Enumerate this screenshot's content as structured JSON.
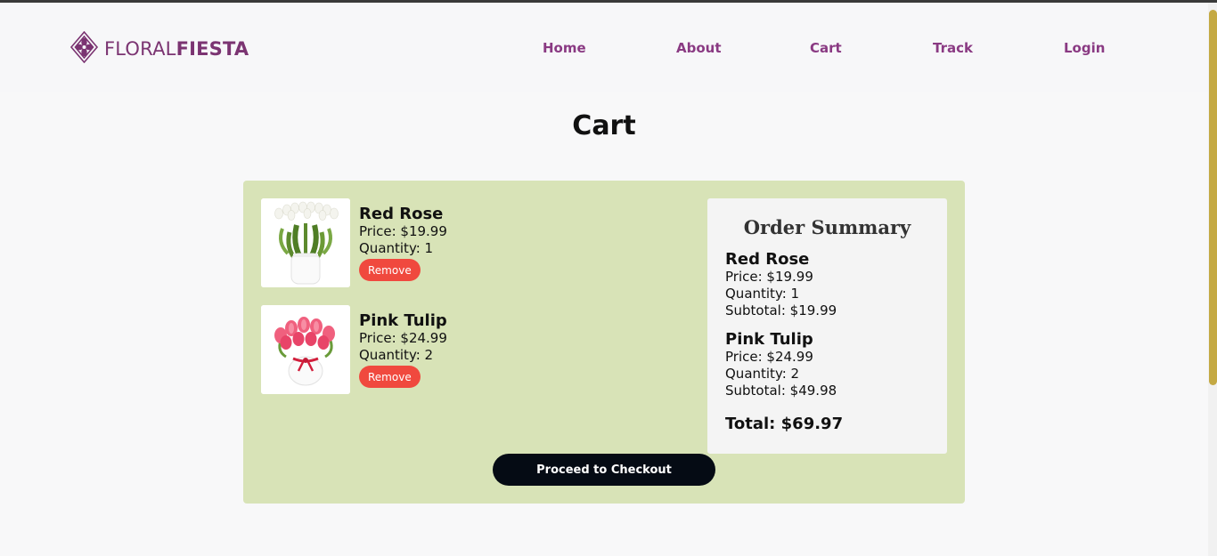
{
  "brand": {
    "name_light": "FLORAL",
    "name_bold": "FIESTA",
    "color": "#7b3472",
    "icon": "flower-diamond-logo-icon"
  },
  "nav": {
    "items": [
      {
        "label": "Home"
      },
      {
        "label": "About"
      },
      {
        "label": "Cart"
      },
      {
        "label": "Track"
      },
      {
        "label": "Login"
      }
    ],
    "color": "#8a3a83"
  },
  "page": {
    "title": "Cart"
  },
  "cart": {
    "panel_color": "#d8e3b7",
    "items": [
      {
        "name": "Red Rose",
        "price": "Price: $19.99",
        "quantity": "Quantity: 1",
        "remove_label": "Remove",
        "image": "white-tulips-vase-image"
      },
      {
        "name": "Pink Tulip",
        "price": "Price: $24.99",
        "quantity": "Quantity: 2",
        "remove_label": "Remove",
        "image": "pink-tulips-vase-image"
      }
    ],
    "checkout_label": "Proceed to Checkout"
  },
  "summary": {
    "title": "Order Summary",
    "items": [
      {
        "name": "Red Rose",
        "price": "Price: $19.99",
        "quantity": "Quantity: 1",
        "subtotal": "Subtotal: $19.99"
      },
      {
        "name": "Pink Tulip",
        "price": "Price: $24.99",
        "quantity": "Quantity: 2",
        "subtotal": "Subtotal: $49.98"
      }
    ],
    "total": "Total: $69.97"
  },
  "colors": {
    "remove": "#f0493e",
    "checkout": "#050b14",
    "scroll_thumb": "#c4a943"
  }
}
